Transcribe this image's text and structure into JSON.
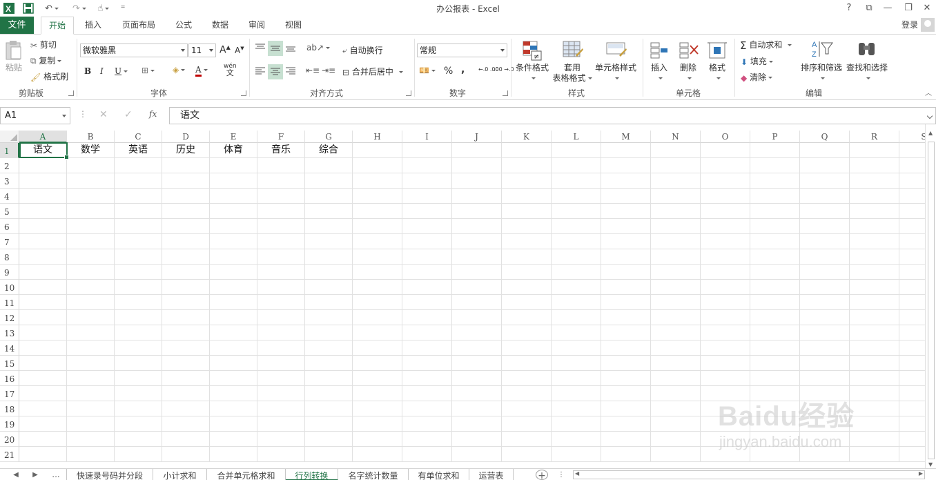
{
  "title_bar": {
    "title": "办公报表 - Excel",
    "help": "?",
    "ribbon_display": "⧉",
    "minimize": "—",
    "restore": "❐",
    "close": "✕"
  },
  "tabs": {
    "file": "文件",
    "items": [
      "开始",
      "插入",
      "页面布局",
      "公式",
      "数据",
      "审阅",
      "视图"
    ],
    "active": "开始",
    "login": "登录"
  },
  "ribbon": {
    "clipboard": {
      "label": "剪贴板",
      "paste": "粘贴",
      "cut": "剪切",
      "copy": "复制",
      "format_painter": "格式刷"
    },
    "font": {
      "label": "字体",
      "font_name": "微软雅黑",
      "font_size": "11",
      "grow": "A",
      "shrink": "A",
      "bold": "B",
      "italic": "I",
      "underline": "U",
      "wen": "wén",
      "wen_char": "文"
    },
    "alignment": {
      "label": "对齐方式",
      "wrap_text": "自动换行",
      "merge_center": "合并后居中"
    },
    "number": {
      "label": "数字",
      "format": "常规",
      "percent": "%",
      "comma": ",",
      "inc_decimal": "←.0 .00",
      "dec_decimal": ".00 →.0"
    },
    "styles": {
      "label": "样式",
      "conditional": "条件格式",
      "table_line1": "套用",
      "table_line2": "表格格式",
      "cell_styles": "单元格样式"
    },
    "cells": {
      "label": "单元格",
      "insert": "插入",
      "delete": "删除",
      "format": "格式"
    },
    "editing": {
      "label": "编辑",
      "autosum": "自动求和",
      "fill": "填充",
      "clear": "清除",
      "sort_filter": "排序和筛选",
      "find_select": "查找和选择"
    }
  },
  "formula_bar": {
    "name_box": "A1",
    "fx": "fx",
    "content": "语文"
  },
  "grid": {
    "columns": [
      "A",
      "B",
      "C",
      "D",
      "E",
      "F",
      "G",
      "H",
      "I",
      "J",
      "K",
      "L",
      "M",
      "N",
      "O",
      "P",
      "Q",
      "R",
      "S"
    ],
    "rows": [
      "1",
      "2",
      "3",
      "4",
      "5",
      "6",
      "7",
      "8",
      "9",
      "10",
      "11",
      "12",
      "13",
      "14",
      "15",
      "16",
      "17",
      "18",
      "19",
      "20",
      "21"
    ],
    "row1_values": [
      "语文",
      "数学",
      "英语",
      "历史",
      "体育",
      "音乐",
      "综合"
    ],
    "selected_cell": "A1"
  },
  "sheets": {
    "ellipsis": "...",
    "items": [
      "快速录号码并分段",
      "小计求和",
      "合并单元格求和",
      "行列转换",
      "名字统计数量",
      "有单位求和",
      "运营表"
    ],
    "active": "行列转换",
    "add": "+"
  },
  "watermark": {
    "brand": "Baidu经验",
    "url": "jingyan.baidu.com"
  },
  "colors": {
    "accent": "#217346",
    "selection_highlight": "#c7e0d1"
  }
}
